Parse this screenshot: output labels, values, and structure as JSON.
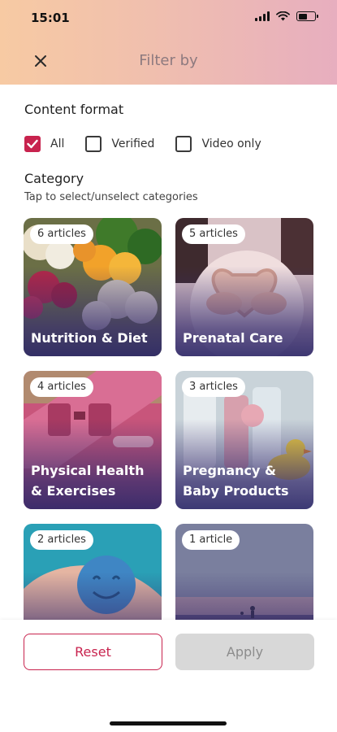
{
  "status_bar": {
    "time": "15:01"
  },
  "header": {
    "title": "Filter by",
    "close_icon": "close-icon"
  },
  "content_format": {
    "title": "Content format",
    "options": [
      {
        "label": "All",
        "checked": true
      },
      {
        "label": "Verified",
        "checked": false
      },
      {
        "label": "Video only",
        "checked": false
      }
    ]
  },
  "category": {
    "title": "Category",
    "hint": "Tap to select/unselect categories",
    "cards": [
      {
        "count": "6 articles",
        "label": "Nutrition & Diet"
      },
      {
        "count": "5 articles",
        "label": "Prenatal Care"
      },
      {
        "count": "4 articles",
        "label": "Physical Health & Exercises"
      },
      {
        "count": "3 articles",
        "label": "Pregnancy & Baby Products"
      },
      {
        "count": "2 articles",
        "label": ""
      },
      {
        "count": "1 article",
        "label": ""
      }
    ]
  },
  "footer": {
    "reset_label": "Reset",
    "apply_label": "Apply"
  },
  "colors": {
    "accent": "#c8234e",
    "header_start": "#f7caa3",
    "header_end": "#e7aebf",
    "disabled": "#d8d8d8"
  }
}
